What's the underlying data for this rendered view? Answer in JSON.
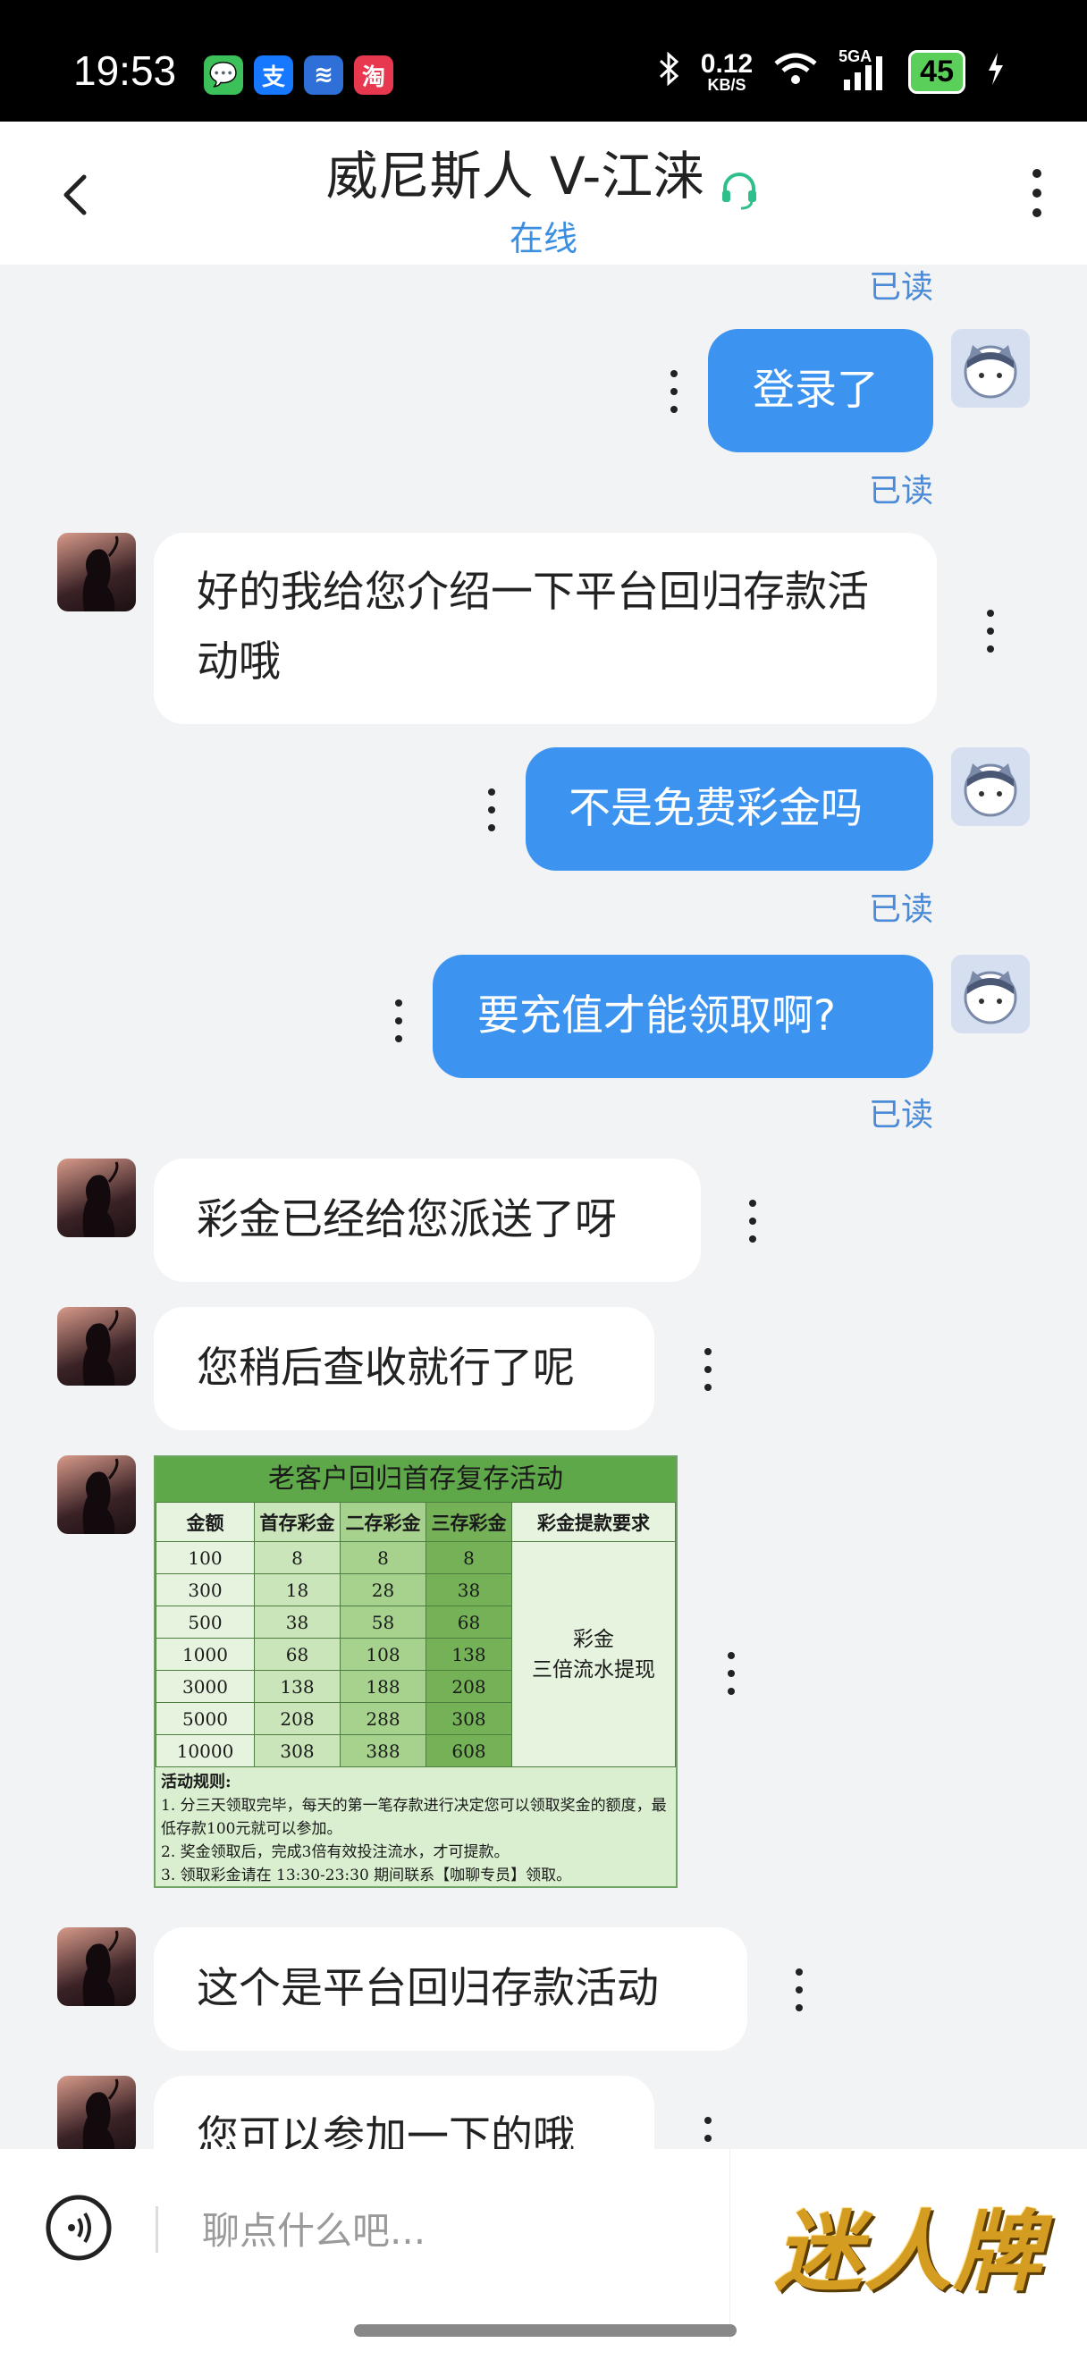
{
  "status_bar": {
    "time": "19:53",
    "app_icons": [
      {
        "name": "messages-app-icon",
        "glyph": "💬",
        "color": "#3cc15a"
      },
      {
        "name": "alipay-app-icon",
        "glyph": "支",
        "color": "#1677ff"
      },
      {
        "name": "wallet-app-icon",
        "glyph": "≋",
        "color": "#2f6fd8"
      },
      {
        "name": "shopping-app-icon",
        "glyph": "淘",
        "color": "#e8384f"
      }
    ],
    "net_speed_value": "0.12",
    "net_speed_unit": "KB/S",
    "network": "5GA",
    "battery": "45"
  },
  "header": {
    "title": "威尼斯人 V-江涞",
    "status": "在线"
  },
  "chat": {
    "read_label": "已读",
    "messages": [
      {
        "side": "out",
        "text": "登录了",
        "read": true
      },
      {
        "side": "in",
        "text": "好的我给您介绍一下平台回归存款活动哦"
      },
      {
        "side": "out",
        "text": "不是免费彩金吗",
        "read": true
      },
      {
        "side": "out",
        "text": "要充值才能领取啊?",
        "read": true
      },
      {
        "side": "in",
        "text": "彩金已经给您派送了呀"
      },
      {
        "side": "in",
        "text": "您稍后查收就行了呢"
      },
      {
        "side": "in",
        "type": "image"
      },
      {
        "side": "in",
        "text": "这个是平台回归存款活动"
      },
      {
        "side": "in",
        "text": "您可以参加一下的哦"
      }
    ]
  },
  "promo": {
    "title": "老客户回归首存复存活动",
    "headers": [
      "金额",
      "首存彩金",
      "二存彩金",
      "三存彩金",
      "彩金提款要求"
    ],
    "rows": [
      [
        "100",
        "8",
        "8",
        "8"
      ],
      [
        "300",
        "18",
        "28",
        "38"
      ],
      [
        "500",
        "38",
        "58",
        "68"
      ],
      [
        "1000",
        "68",
        "108",
        "138"
      ],
      [
        "3000",
        "138",
        "188",
        "208"
      ],
      [
        "5000",
        "208",
        "288",
        "308"
      ],
      [
        "10000",
        "308",
        "388",
        "608"
      ]
    ],
    "requirement_line1": "彩金",
    "requirement_line2": "三倍流水提现",
    "rules_title": "活动规则:",
    "rules": [
      "1. 分三天领取完毕，每天的第一笔存款进行决定您可以领取奖金的额度，最低存款100元就可以参加。",
      "2. 奖金领取后，完成3倍有效投注流水，才可提款。",
      "3. 领取彩金请在 13:30-23:30 期间联系【咖聊专员】领取。"
    ]
  },
  "input": {
    "placeholder": "聊点什么吧..."
  },
  "brand": {
    "text": "迷人牌"
  }
}
